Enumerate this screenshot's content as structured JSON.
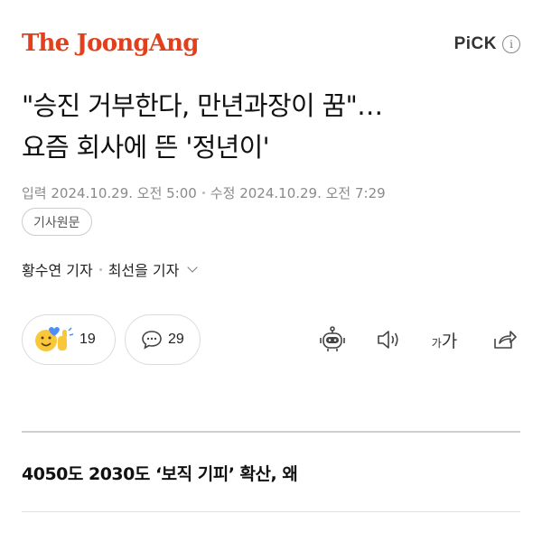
{
  "brand": {
    "name": "The JoongAng",
    "color": "#e2401c"
  },
  "pick": {
    "label": "PiCK",
    "info_glyph": "i"
  },
  "article": {
    "headline_line1": "\"승진 거부한다, 만년과장이 꿈\"…",
    "headline_line2": "요즘 회사에 뜬 '정년이'",
    "published": "입력 2024.10.29. 오전 5:00",
    "modified": "수정 2024.10.29. 오전 7:29",
    "source_button": "기사원문",
    "reporter1": "황수연 기자",
    "reporter2": "최선을 기자",
    "subheading": "4050도 2030도 ‘보직 기피’ 확산, 왜"
  },
  "reactions": {
    "reaction_count": "19",
    "comment_count": "29"
  },
  "toolbar": {
    "icons": [
      "ai-robot-icon",
      "speaker-icon",
      "font-size-icon",
      "share-icon"
    ],
    "font_small": "가",
    "font_large": "가"
  }
}
